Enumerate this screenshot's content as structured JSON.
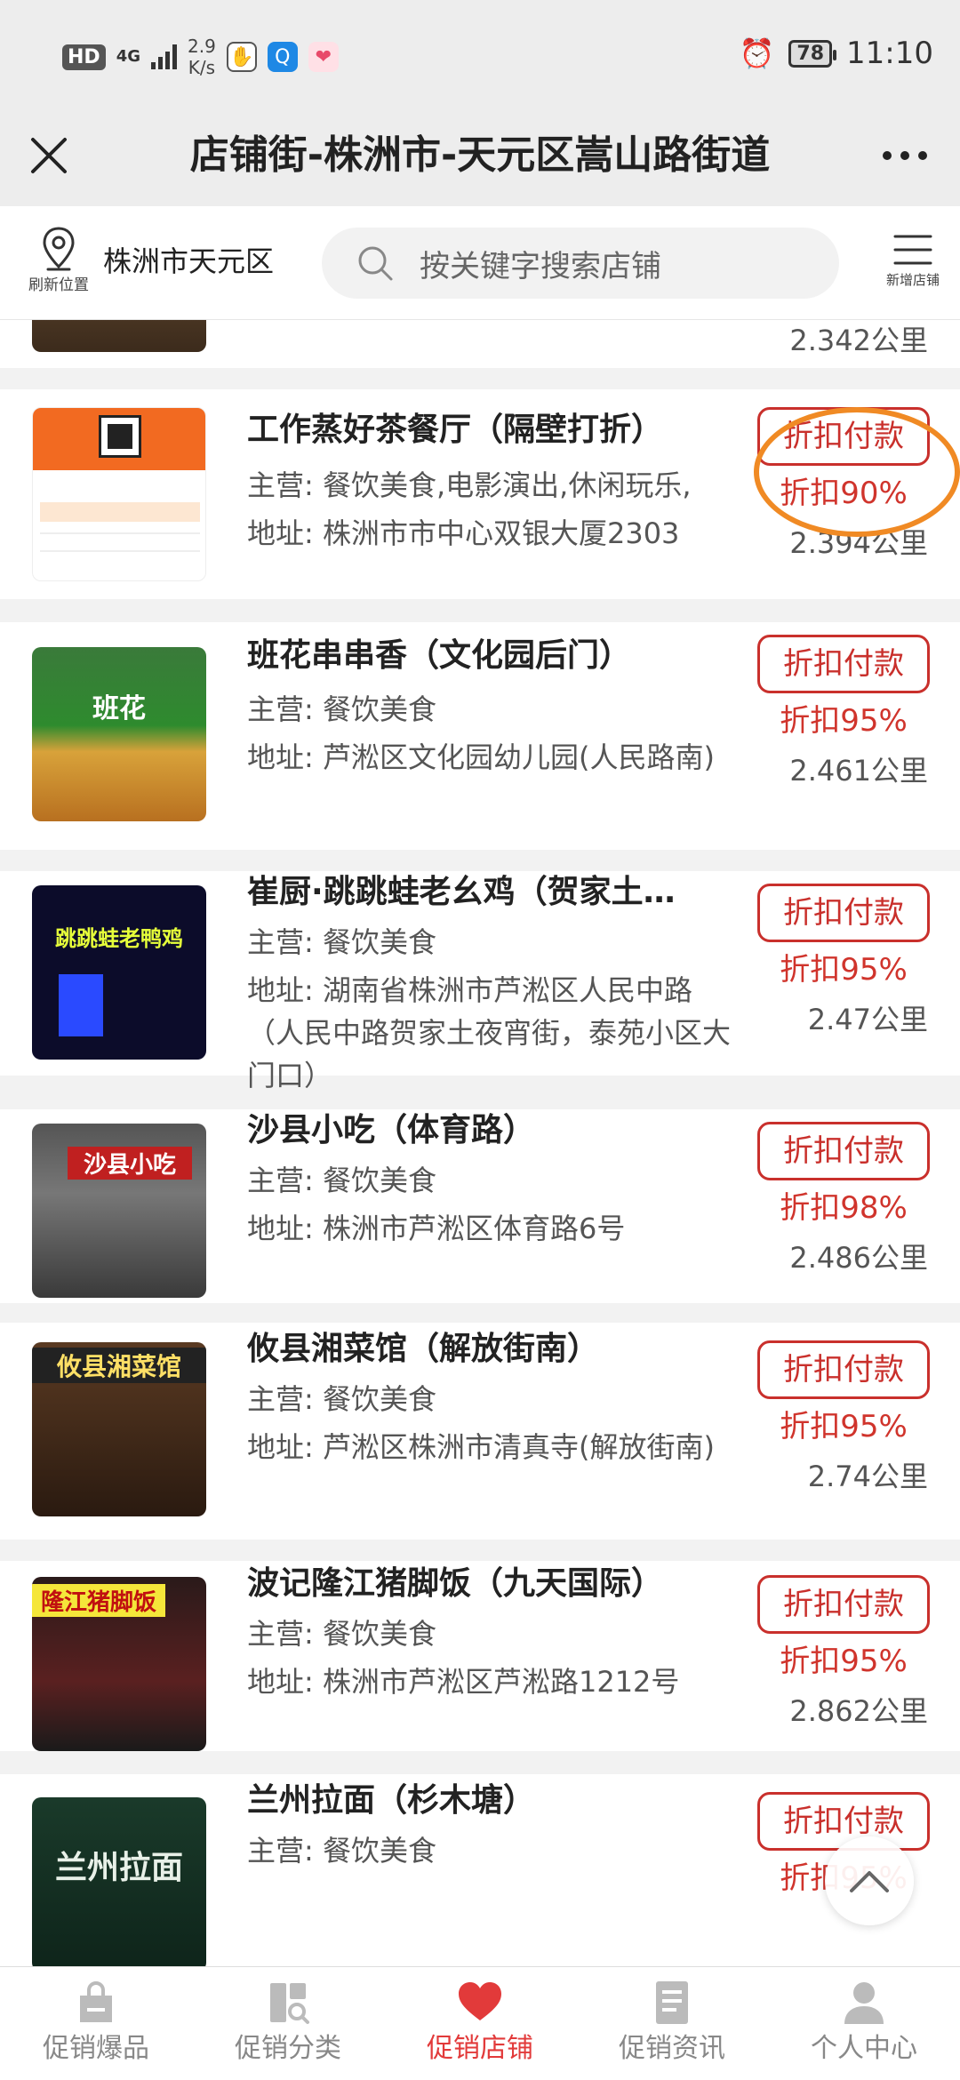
{
  "status_bar": {
    "hd": "HD",
    "net": "4G",
    "speed_value": "2.9",
    "speed_unit": "K/s",
    "battery": "78",
    "time": "11:10"
  },
  "title_bar": {
    "title": "店铺街-株洲市-天元区嵩山路街道"
  },
  "search_row": {
    "refresh_label": "刷新位置",
    "city": "株洲市天元区",
    "search_placeholder": "按关键字搜索店铺",
    "add_store_label": "新增店铺"
  },
  "partial_top": {
    "distance": "2.342公里"
  },
  "labels": {
    "main_prefix": "主营:",
    "addr_prefix": "地址:",
    "pay": "折扣付款"
  },
  "stores": [
    {
      "name": "工作蒸好茶餐厅（隔壁打折）",
      "main": "餐饮美食,电影演出,休闲玩乐,",
      "address": "株洲市市中心双银大厦2303",
      "discount": "折扣90%",
      "distance": "2.394公里"
    },
    {
      "name": "班花串串香（文化园后门）",
      "main": "餐饮美食",
      "address": "芦淞区文化园幼儿园(人民路南)",
      "discount": "折扣95%",
      "distance": "2.461公里"
    },
    {
      "name": "崔厨·跳跳蛙老幺鸡（贺家土…",
      "main": "餐饮美食",
      "address": "湖南省株洲市芦淞区人民中路（人民中路贺家土夜宵街，泰苑小区大门口）",
      "discount": "折扣95%",
      "distance": "2.47公里"
    },
    {
      "name": "沙县小吃（体育路）",
      "main": "餐饮美食",
      "address": "株洲市芦淞区体育路6号",
      "discount": "折扣98%",
      "distance": "2.486公里"
    },
    {
      "name": "攸县湘菜馆（解放街南）",
      "main": "餐饮美食",
      "address": "芦淞区株洲市清真寺(解放街南)",
      "discount": "折扣95%",
      "distance": "2.74公里"
    },
    {
      "name": "波记隆江猪脚饭（九天国际）",
      "main": "餐饮美食",
      "address": "株洲市芦淞区芦淞路1212号",
      "discount": "折扣95%",
      "distance": "2.862公里"
    },
    {
      "name": "兰州拉面（杉木塘）",
      "main": "餐饮美食",
      "address": "",
      "discount": "折扣95%",
      "distance": ""
    }
  ],
  "thumb_texts": {
    "store2": "班花",
    "store3": "跳跳蛙老鸭鸡",
    "store4": "沙县小吃",
    "store5": "攸县湘菜馆",
    "store6": "隆江猪脚饭",
    "store7": "兰州拉面"
  },
  "bottom_nav": {
    "items": [
      "促销爆品",
      "促销分类",
      "促销店铺",
      "促销资讯",
      "个人中心"
    ],
    "active_index": 2
  },
  "colors": {
    "accent_red": "#c9302c",
    "active_red": "#e23a3a",
    "highlight_orange": "#f08a24"
  }
}
